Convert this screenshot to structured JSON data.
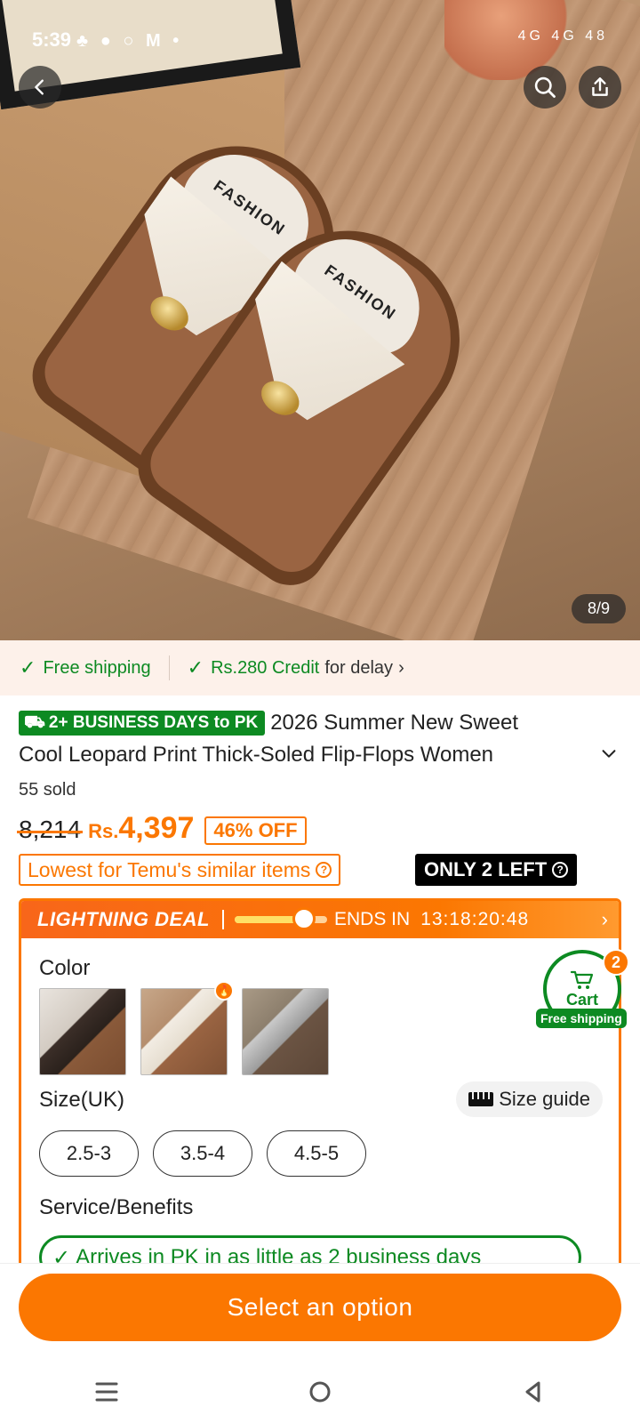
{
  "status_bar": {
    "time": "5:39",
    "left_icons": "♣ ● ○ M •",
    "right_icons": "4G 4G 48"
  },
  "image": {
    "counter": "8/9",
    "pad_text": "FASHION"
  },
  "shipping_bar": {
    "free_shipping": "Free shipping",
    "credit": "Rs.280 Credit",
    "credit_suffix": "for delay",
    "chevron": "›"
  },
  "product": {
    "delivery_badge": "2+ BUSINESS DAYS to PK",
    "title_line1": "2026 Summer New Sweet",
    "title_line2": "Cool Leopard Print Thick-Soled Flip-Flops Women",
    "sold": "55 sold",
    "original_price": "8,214",
    "currency": "Rs.",
    "price": "4,397",
    "discount": "46% OFF",
    "lowest_label": "Lowest for Temu's similar items",
    "stock_label": "ONLY 2 LEFT"
  },
  "deal": {
    "title": "LIGHTNING DEAL",
    "ends_label": "ENDS IN",
    "time_left": "13:18:20:48",
    "progress_percent": 75
  },
  "options": {
    "color_label": "Color",
    "size_label": "Size(UK)",
    "size_guide": "Size guide",
    "sizes": [
      "2.5-3",
      "3.5-4",
      "4.5-5"
    ],
    "service_label": "Service/Benefits",
    "arrives_text": "Arrives in PK in as little as 2 business days"
  },
  "cart": {
    "label": "Cart",
    "count": "2",
    "free_shipping": "Free shipping"
  },
  "cta": {
    "label": "Select an option"
  },
  "colors": {
    "accent": "#fb7701",
    "green": "#0d8a22"
  }
}
